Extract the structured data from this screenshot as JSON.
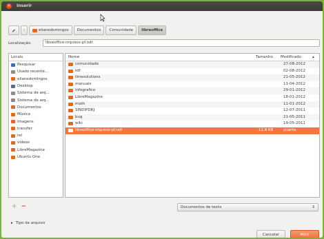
{
  "window": {
    "title": "Inserir"
  },
  "pathbar": {
    "edit_icon": "pencil-icon",
    "back_icon": "chevron-left-icon",
    "crumbs": [
      "elianedomingos",
      "Documentos",
      "Comunidade",
      "libreoffice"
    ]
  },
  "location": {
    "label": "Localização:",
    "value": "libreoffice-impress-pf.odt"
  },
  "places": {
    "header": "Locais",
    "items": [
      {
        "label": "Pesquisar",
        "icon": "search-icon",
        "color": "#3a6fb0"
      },
      {
        "label": "Usado recente...",
        "icon": "clock-icon",
        "color": "#8a8a8a"
      },
      {
        "label": "elianedomingos",
        "icon": "home-folder-icon",
        "color": "#df6a25"
      },
      {
        "label": "Desktop",
        "icon": "desktop-icon",
        "color": "#5a6f8c"
      },
      {
        "label": "Sistema de arq...",
        "icon": "drive-icon",
        "color": "#8a8a8a"
      },
      {
        "label": "Sistema de arq...",
        "icon": "drive-icon",
        "color": "#8a8a8a"
      },
      {
        "label": "Documentos",
        "icon": "folder-icon",
        "color": "#df6a25"
      },
      {
        "label": "Música",
        "icon": "music-folder-icon",
        "color": "#df6a25"
      },
      {
        "label": "Imagens",
        "icon": "pictures-folder-icon",
        "color": "#df6a25"
      },
      {
        "label": "transfer",
        "icon": "folder-icon",
        "color": "#df6a25"
      },
      {
        "label": "rel",
        "icon": "folder-icon",
        "color": "#df6a25"
      },
      {
        "label": "videos",
        "icon": "videos-folder-icon",
        "color": "#df6a25"
      },
      {
        "label": "LibreMagazine",
        "icon": "folder-icon",
        "color": "#df6a25"
      },
      {
        "label": "Ubuntu One",
        "icon": "folder-icon",
        "color": "#df6a25"
      }
    ]
  },
  "files": {
    "columns": {
      "name": "Nome",
      "size": "Tamanho",
      "modified": "Modificado"
    },
    "rows": [
      {
        "name": "comunidade",
        "size": "",
        "date": "27-08-2012"
      },
      {
        "name": "tdf",
        "size": "",
        "date": "02-08-2012"
      },
      {
        "name": "limesolutions",
        "size": "",
        "date": "21-05-2012"
      },
      {
        "name": "manuais",
        "size": "",
        "date": "11-04-2012"
      },
      {
        "name": "infografico",
        "size": "",
        "date": "29-01-2012"
      },
      {
        "name": "LibreMagazine",
        "size": "",
        "date": "18-01-2012"
      },
      {
        "name": "math",
        "size": "",
        "date": "11-01-2012"
      },
      {
        "name": "SINDIPDRJ",
        "size": "",
        "date": "12-07-2011"
      },
      {
        "name": "bug",
        "size": "",
        "date": "21-05-2011"
      },
      {
        "name": "wiki",
        "size": "",
        "date": "19-05-2011"
      },
      {
        "name": "libreoffice-impress-pf.odt",
        "size": "11,8 KB",
        "date": "quarta",
        "selected": true
      }
    ]
  },
  "filter": {
    "value": "Documentos de texto"
  },
  "file_types": {
    "label": "Tipo de arquivo"
  },
  "buttons": {
    "cancel": "Cancelar",
    "open": "Abrir"
  },
  "colors": {
    "accent": "#f07746",
    "close": "#df4a16"
  }
}
